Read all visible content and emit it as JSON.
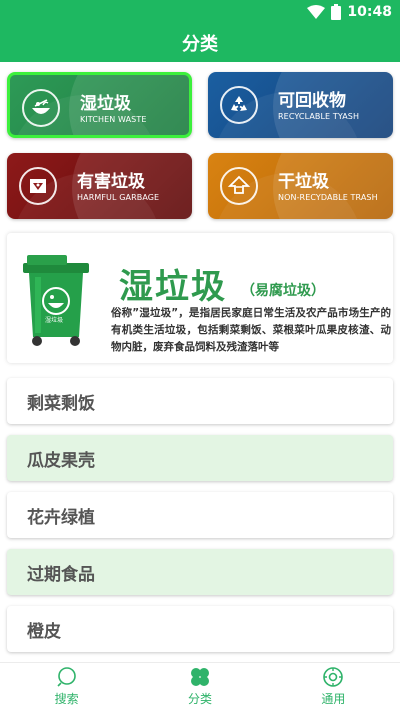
{
  "status_bar": {
    "time": "10:48"
  },
  "app_bar": {
    "title": "分类"
  },
  "categories": [
    {
      "title": "湿垃圾",
      "subtitle": "KITCHEN WASTE",
      "selected": true
    },
    {
      "title": "可回收物",
      "subtitle": "RECYCLABLE TYASH",
      "selected": false
    },
    {
      "title": "有害垃圾",
      "subtitle": "HARMFUL GARBAGE",
      "selected": false
    },
    {
      "title": "干垃圾",
      "subtitle": "NON-RECYDABLE TRASH",
      "selected": false
    }
  ],
  "detail": {
    "title": "湿垃圾",
    "alias": "（易腐垃圾）",
    "bin_label": "湿垃圾",
    "description": "俗称”湿垃圾”，是指居民家庭日常生活及农产品市场生产的有机类生活垃圾，包括剩菜剩饭、菜根菜叶瓜果皮核渣、动物内脏，废弃食品饲料及残渣落叶等"
  },
  "items": [
    "剩菜剩饭",
    "瓜皮果壳",
    "花卉绿植",
    "过期食品",
    "橙皮"
  ],
  "bottom_nav": [
    {
      "label": "搜索",
      "icon": "search-icon"
    },
    {
      "label": "分类",
      "icon": "clover-icon"
    },
    {
      "label": "通用",
      "icon": "settings-icon"
    }
  ],
  "colors": {
    "primary": "#1eb861",
    "wet": "#1d7d40",
    "recyclable": "#123f78",
    "harmful": "#5e0909",
    "dry": "#b56406",
    "selected_border": "#3cf03c",
    "row_tint": "#e3f5e3"
  }
}
